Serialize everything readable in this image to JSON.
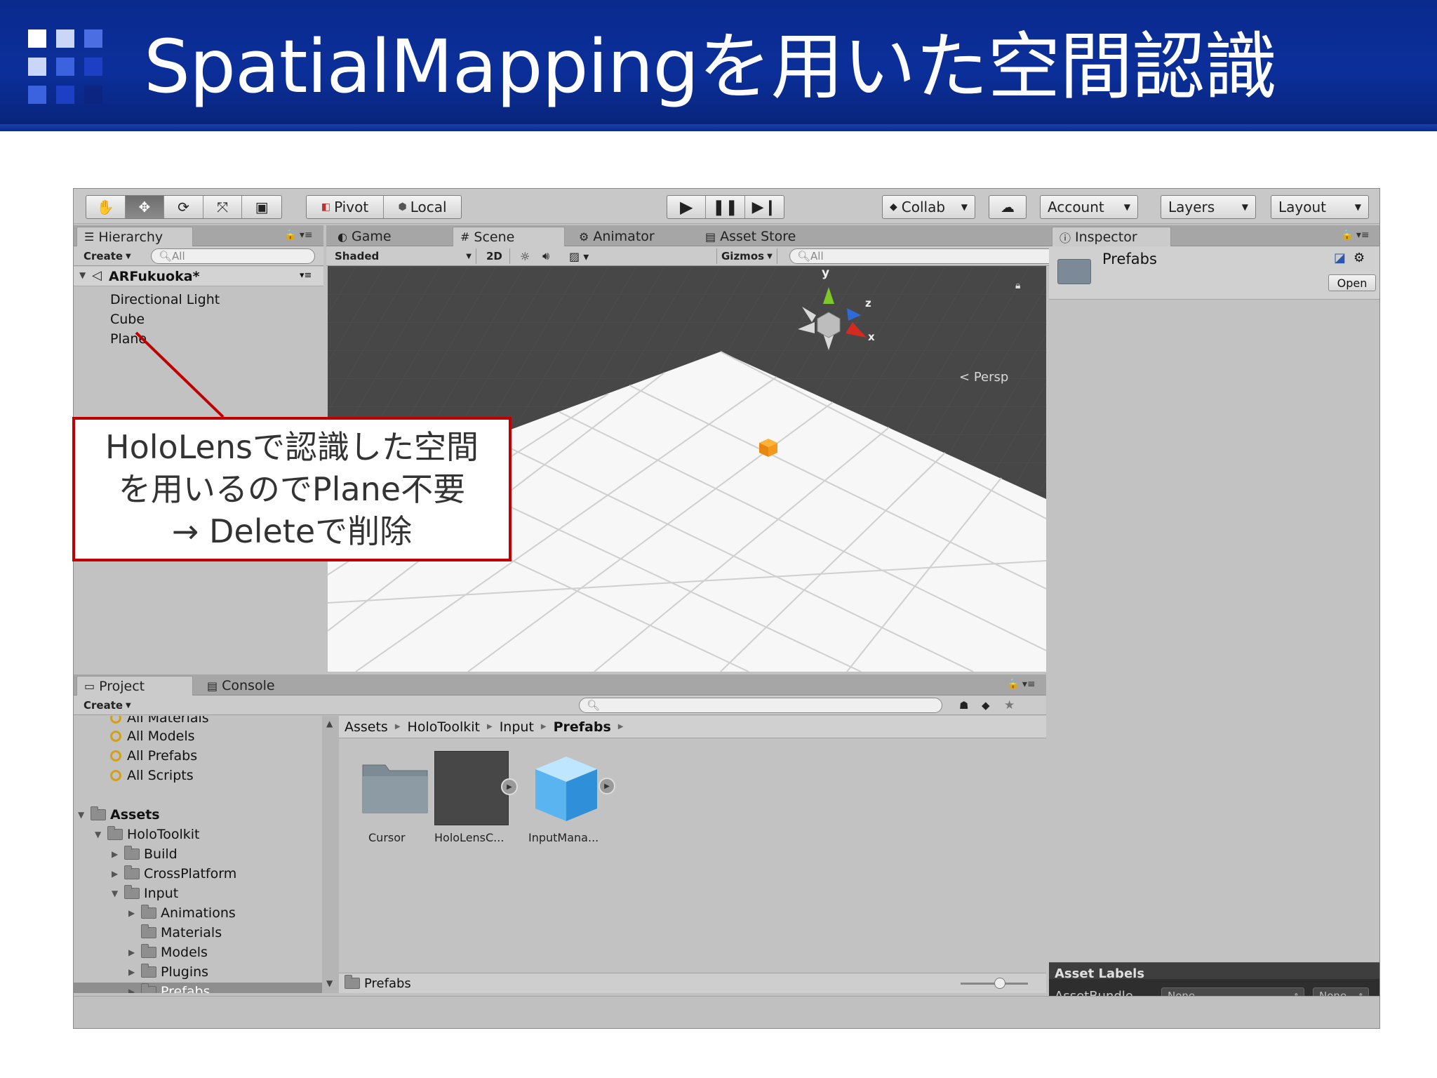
{
  "slide": {
    "title": "SpatialMappingを用いた空間認識",
    "logo_colors": [
      "#ffffff",
      "#9fb4ee",
      "#3b63e0",
      "#1d3fc4",
      "#0b2580"
    ]
  },
  "toolbar": {
    "pivot_label": "Pivot",
    "local_label": "Local",
    "collab_label": "Collab",
    "account_label": "Account",
    "layers_label": "Layers",
    "layout_label": "Layout"
  },
  "hierarchy": {
    "tab_label": "Hierarchy",
    "create_label": "Create",
    "search_placeholder": "All",
    "scene_name": "ARFukuoka*",
    "items": [
      "Directional Light",
      "Cube",
      "Plane"
    ]
  },
  "center_tabs": {
    "game": "Game",
    "scene": "Scene",
    "animator": "Animator",
    "asset_store": "Asset Store"
  },
  "scene_toolbar": {
    "shading": "Shaded",
    "mode_2d": "2D",
    "gizmos": "Gizmos",
    "search_placeholder": "All"
  },
  "scene_view": {
    "persp_label": "Persp",
    "axis_y": "y",
    "axis_z": "z",
    "axis_x": "x"
  },
  "inspector": {
    "tab_label": "Inspector",
    "asset_name": "Prefabs",
    "open_label": "Open",
    "asset_labels_title": "Asset Labels",
    "assetbundle_label": "AssetBundle",
    "assetbundle_value": "None",
    "variant_value": "None"
  },
  "project": {
    "tab_label": "Project",
    "console_label": "Console",
    "create_label": "Create",
    "favorites": [
      "All Materials",
      "All Models",
      "All Prefabs",
      "All Scripts"
    ],
    "tree": [
      {
        "label": "Assets"
      },
      {
        "label": "HoloToolkit"
      },
      {
        "label": "Build"
      },
      {
        "label": "CrossPlatform"
      },
      {
        "label": "Input"
      },
      {
        "label": "Animations"
      },
      {
        "label": "Materials"
      },
      {
        "label": "Models"
      },
      {
        "label": "Plugins"
      },
      {
        "label": "Prefabs"
      }
    ],
    "breadcrumb": [
      "Assets",
      "HoloToolkit",
      "Input",
      "Prefabs"
    ],
    "assets": [
      "Cursor",
      "HoloLensC...",
      "InputMana..."
    ],
    "footer_path": "Prefabs"
  },
  "callout": {
    "line1": "HoloLensで認識した空間",
    "line2": "を用いるのでPlane不要",
    "line3": "→ Deleteで削除",
    "border_color": "#c00000"
  }
}
